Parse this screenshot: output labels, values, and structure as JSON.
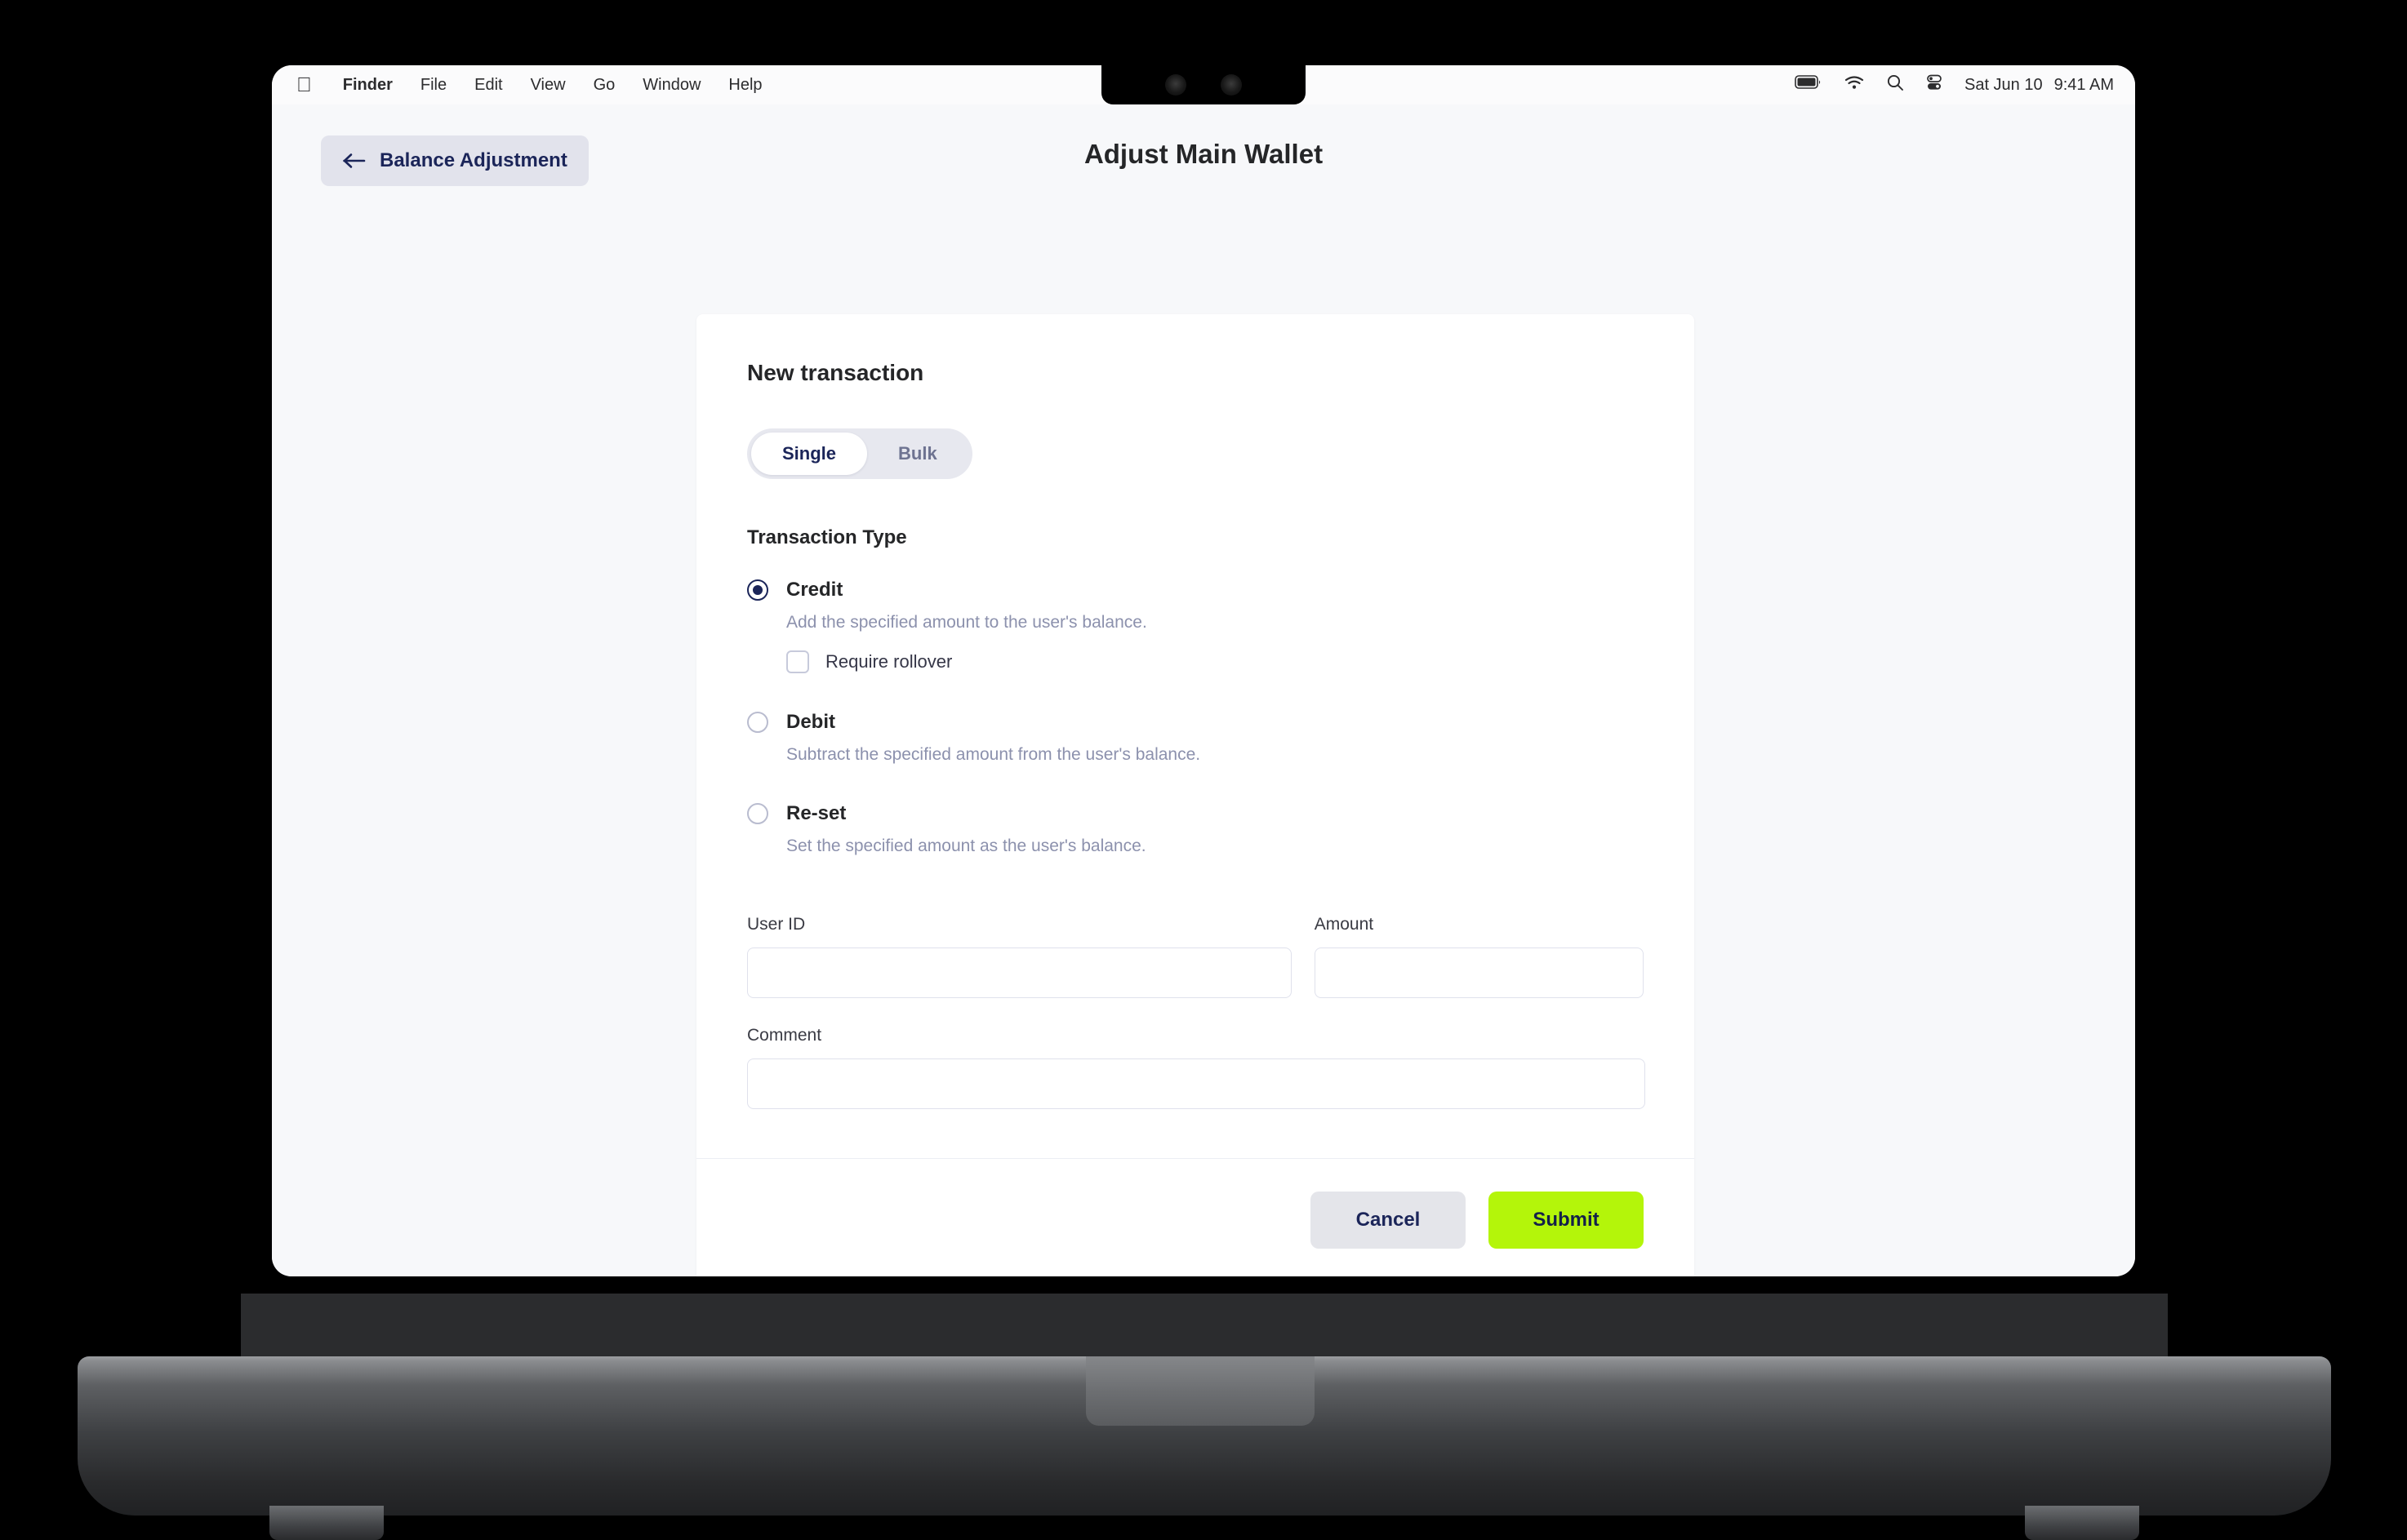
{
  "menu_bar": {
    "apple_icon": "apple-logo",
    "items": [
      {
        "label": "Finder",
        "bold": true
      },
      {
        "label": "File",
        "bold": false
      },
      {
        "label": "Edit",
        "bold": false
      },
      {
        "label": "View",
        "bold": false
      },
      {
        "label": "Go",
        "bold": false
      },
      {
        "label": "Window",
        "bold": false
      },
      {
        "label": "Help",
        "bold": false
      }
    ],
    "status_icons": [
      "battery-icon",
      "wifi-icon",
      "search-icon",
      "control-center-icon"
    ],
    "date": "Sat Jun 10",
    "time": "9:41 AM"
  },
  "header": {
    "back_button_label": "Balance Adjustment",
    "back_icon": "arrow-left-icon",
    "title": "Adjust Main Wallet"
  },
  "card": {
    "title": "New transaction",
    "mode_tabs": [
      {
        "label": "Single",
        "active": true
      },
      {
        "label": "Bulk",
        "active": false
      }
    ],
    "transaction_type_label": "Transaction Type",
    "transaction_types": [
      {
        "label": "Credit",
        "description": "Add the specified amount to the user's balance.",
        "selected": true,
        "checkbox": {
          "label": "Require rollover",
          "checked": false
        }
      },
      {
        "label": "Debit",
        "description": "Subtract the specified amount from the user's balance.",
        "selected": false
      },
      {
        "label": "Re-set",
        "description": "Set the specified amount as the user's balance.",
        "selected": false
      }
    ],
    "fields": {
      "user_id": {
        "label": "User ID",
        "value": "",
        "placeholder": ""
      },
      "amount": {
        "label": "Amount",
        "value": "",
        "placeholder": ""
      },
      "comment": {
        "label": "Comment",
        "value": "",
        "placeholder": ""
      }
    },
    "footer": {
      "cancel_label": "Cancel",
      "submit_label": "Submit"
    }
  },
  "colors": {
    "accent_green": "#b4f50a",
    "navy": "#1b2559",
    "page_background": "#f7f8fa",
    "muted_text": "#8c91ad",
    "border": "#dfe1ec"
  }
}
